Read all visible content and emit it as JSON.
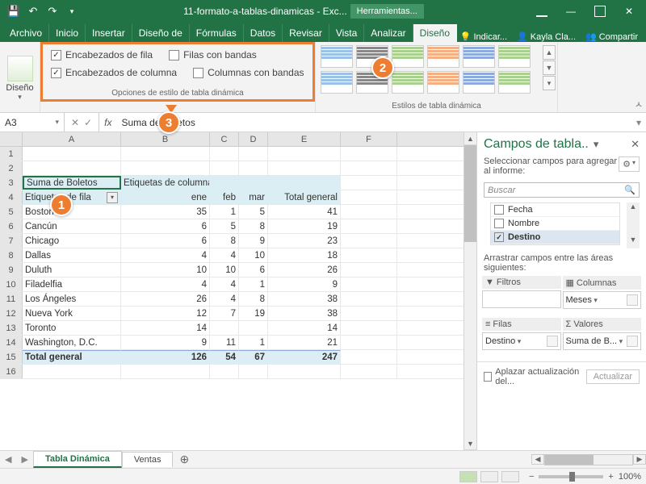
{
  "titlebar": {
    "doc": "11-formato-a-tablas-dinamicas - Exc...",
    "tools": "Herramientas..."
  },
  "tabs": {
    "items": [
      "Archivo",
      "Inicio",
      "Insertar",
      "Diseño de",
      "Fórmulas",
      "Datos",
      "Revisar",
      "Vista",
      "Analizar",
      "Diseño"
    ],
    "active": "Diseño",
    "tell": "Indicar...",
    "user": "Kayla Cla...",
    "share": "Compartir"
  },
  "ribbon": {
    "design_label": "Diseño",
    "options": {
      "row_headers": "Encabezados de fila",
      "col_headers": "Encabezados de columna",
      "banded_rows": "Filas con bandas",
      "banded_cols": "Columnas con bandas",
      "group": "Opciones de estilo de tabla dinámica"
    },
    "styles_group": "Estilos de tabla dinámica"
  },
  "namebox": "A3",
  "formula": "Suma de Boletos",
  "cols": [
    "A",
    "B",
    "C",
    "D",
    "E",
    "F"
  ],
  "pivot": {
    "corner": "Suma de Boletos",
    "col_labels": "Etiquetas de columna",
    "row_labels": "Etiquetas de fila",
    "months": [
      "ene",
      "feb",
      "mar"
    ],
    "grand_col": "Total general",
    "rows": [
      {
        "label": "Boston",
        "v": [
          35,
          1,
          5
        ],
        "t": 41
      },
      {
        "label": "Cancún",
        "v": [
          6,
          5,
          8
        ],
        "t": 19
      },
      {
        "label": "Chicago",
        "v": [
          6,
          8,
          9
        ],
        "t": 23
      },
      {
        "label": "Dallas",
        "v": [
          4,
          4,
          10
        ],
        "t": 18
      },
      {
        "label": "Duluth",
        "v": [
          10,
          10,
          6
        ],
        "t": 26
      },
      {
        "label": "Filadelfia",
        "v": [
          4,
          4,
          1
        ],
        "t": 9
      },
      {
        "label": "Los Ángeles",
        "v": [
          26,
          4,
          8
        ],
        "t": 38
      },
      {
        "label": "Nueva York",
        "v": [
          12,
          7,
          19
        ],
        "t": 38
      },
      {
        "label": "Toronto",
        "v": [
          14,
          "",
          ""
        ],
        "t": 14
      },
      {
        "label": "Washington, D.C.",
        "v": [
          9,
          11,
          1
        ],
        "t": 21
      }
    ],
    "grand_row": "Total general",
    "grand_vals": [
      126,
      54,
      67
    ],
    "grand_total": 247
  },
  "pane": {
    "title": "Campos de tabla..",
    "sub": "Seleccionar campos para agregar al informe:",
    "search": "Buscar",
    "fields": [
      {
        "name": "Fecha",
        "checked": false
      },
      {
        "name": "Nombre",
        "checked": false
      },
      {
        "name": "Destino",
        "checked": true
      }
    ],
    "drag": "Arrastrar campos entre las áreas siguientes:",
    "areas": {
      "filters": "Filtros",
      "columns": "Columnas",
      "columns_val": "Meses",
      "rows": "Filas",
      "rows_val": "Destino",
      "values": "Valores",
      "values_val": "Suma de B..."
    },
    "defer": "Aplazar actualización del...",
    "update": "Actualizar"
  },
  "sheets": {
    "active": "Tabla Dinámica",
    "other": "Ventas"
  },
  "status": {
    "zoom": "100%"
  },
  "callouts": {
    "c1": "1",
    "c2": "2",
    "c3": "3"
  }
}
